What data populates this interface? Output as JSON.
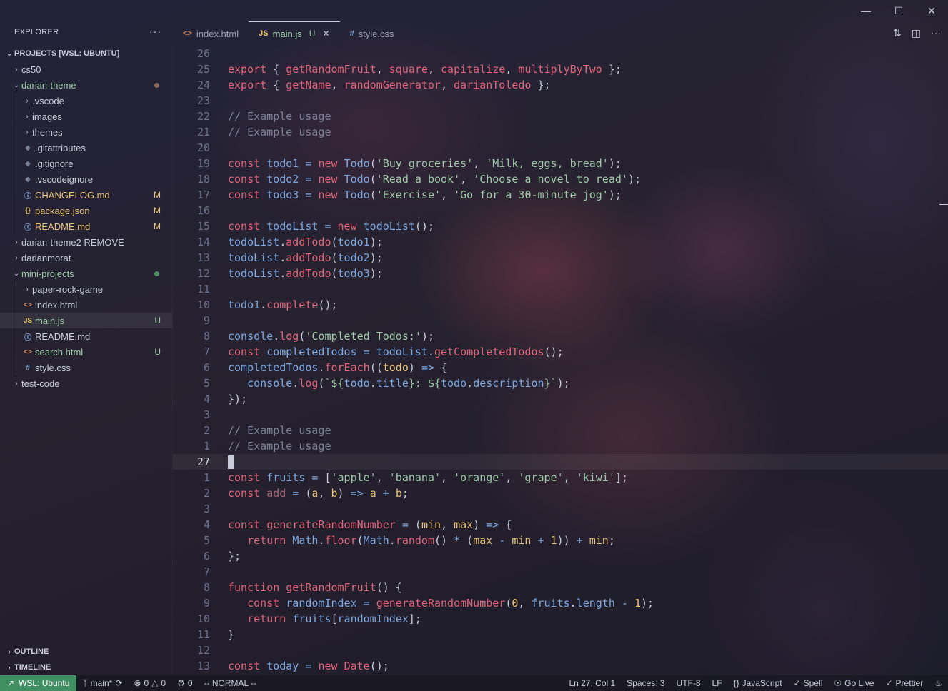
{
  "explorer": {
    "title": "EXPLORER",
    "more": "···",
    "root": "PROJECTS [WSL: UBUNTU]",
    "tree": [
      {
        "label": "cs50",
        "type": "folder",
        "open": false,
        "indent": 0
      },
      {
        "label": "darian-theme",
        "type": "folder",
        "open": true,
        "indent": 0,
        "color": "green",
        "dot": "#8a6a5a"
      },
      {
        "label": ".vscode",
        "type": "folder",
        "open": false,
        "indent": 1
      },
      {
        "label": "images",
        "type": "folder",
        "open": false,
        "indent": 1
      },
      {
        "label": "themes",
        "type": "folder",
        "open": false,
        "indent": 1
      },
      {
        "label": ".gitattributes",
        "type": "file",
        "icon": "◆",
        "iconColor": "muted",
        "indent": 1
      },
      {
        "label": ".gitignore",
        "type": "file",
        "icon": "◆",
        "iconColor": "muted",
        "indent": 1
      },
      {
        "label": ".vscodeignore",
        "type": "file",
        "icon": "◆",
        "iconColor": "muted",
        "indent": 1
      },
      {
        "label": "CHANGELOG.md",
        "type": "file",
        "icon": "ⓘ",
        "iconColor": "blue",
        "indent": 1,
        "color": "yellow",
        "badge": "M"
      },
      {
        "label": "package.json",
        "type": "file",
        "icon": "{}",
        "iconColor": "yellow",
        "indent": 1,
        "color": "yellow",
        "badge": "M"
      },
      {
        "label": "README.md",
        "type": "file",
        "icon": "ⓘ",
        "iconColor": "blue",
        "indent": 1,
        "color": "yellow",
        "badge": "M"
      },
      {
        "label": "darian-theme2 REMOVE",
        "type": "folder",
        "open": false,
        "indent": 0
      },
      {
        "label": "darianmorat",
        "type": "folder",
        "open": false,
        "indent": 0
      },
      {
        "label": "mini-projects",
        "type": "folder",
        "open": true,
        "indent": 0,
        "color": "green",
        "dot": "#4f8f63"
      },
      {
        "label": "paper-rock-game",
        "type": "folder",
        "open": false,
        "indent": 1
      },
      {
        "label": "index.html",
        "type": "file",
        "icon": "<>",
        "iconColor": "orange",
        "indent": 1
      },
      {
        "label": "main.js",
        "type": "file",
        "icon": "JS",
        "iconColor": "yellow",
        "indent": 1,
        "color": "green",
        "badge": "U",
        "selected": true
      },
      {
        "label": "README.md",
        "type": "file",
        "icon": "ⓘ",
        "iconColor": "blue",
        "indent": 1
      },
      {
        "label": "search.html",
        "type": "file",
        "icon": "<>",
        "iconColor": "orange",
        "indent": 1,
        "color": "green",
        "badge": "U"
      },
      {
        "label": "style.css",
        "type": "file",
        "icon": "#",
        "iconColor": "blue",
        "indent": 1
      },
      {
        "label": "test-code",
        "type": "folder",
        "open": false,
        "indent": 0
      }
    ],
    "outline": "OUTLINE",
    "timeline": "TIMELINE"
  },
  "tabs": [
    {
      "label": "index.html",
      "icon": "<>",
      "iconColor": "orange",
      "active": false
    },
    {
      "label": "main.js",
      "icon": "JS",
      "iconColor": "yellow",
      "active": true,
      "status": "U",
      "close": "✕"
    },
    {
      "label": "style.css",
      "icon": "#",
      "iconColor": "blue",
      "active": false
    }
  ],
  "editor": {
    "cursor_line": 27,
    "lines": [
      {
        "n": "26",
        "tokens": []
      },
      {
        "n": "25",
        "tokens": [
          [
            "kw",
            "export"
          ],
          [
            "p",
            " { "
          ],
          [
            "fn",
            "getRandomFruit"
          ],
          [
            "p",
            ", "
          ],
          [
            "fn",
            "square"
          ],
          [
            "p",
            ", "
          ],
          [
            "fn",
            "capitalize"
          ],
          [
            "p",
            ", "
          ],
          [
            "fn",
            "multiplyByTwo"
          ],
          [
            "p",
            " };"
          ]
        ]
      },
      {
        "n": "24",
        "tokens": [
          [
            "kw",
            "export"
          ],
          [
            "p",
            " { "
          ],
          [
            "fn",
            "getName"
          ],
          [
            "p",
            ", "
          ],
          [
            "fn",
            "randomGenerator"
          ],
          [
            "p",
            ", "
          ],
          [
            "fn",
            "darianToledo"
          ],
          [
            "p",
            " };"
          ]
        ]
      },
      {
        "n": "23",
        "tokens": []
      },
      {
        "n": "22",
        "tokens": [
          [
            "cmt",
            "// Example usage"
          ]
        ]
      },
      {
        "n": "21",
        "tokens": [
          [
            "cmt",
            "// Example usage"
          ]
        ]
      },
      {
        "n": "20",
        "tokens": []
      },
      {
        "n": "19",
        "tokens": [
          [
            "kw",
            "const "
          ],
          [
            "var",
            "todo1"
          ],
          [
            "op",
            " = "
          ],
          [
            "kw",
            "new "
          ],
          [
            "var",
            "Todo"
          ],
          [
            "p",
            "("
          ],
          [
            "str",
            "'Buy groceries'"
          ],
          [
            "p",
            ", "
          ],
          [
            "str",
            "'Milk, eggs, bread'"
          ],
          [
            "p",
            ");"
          ]
        ]
      },
      {
        "n": "18",
        "tokens": [
          [
            "kw",
            "const "
          ],
          [
            "var",
            "todo2"
          ],
          [
            "op",
            " = "
          ],
          [
            "kw",
            "new "
          ],
          [
            "var",
            "Todo"
          ],
          [
            "p",
            "("
          ],
          [
            "str",
            "'Read a book'"
          ],
          [
            "p",
            ", "
          ],
          [
            "str",
            "'Choose a novel to read'"
          ],
          [
            "p",
            ");"
          ]
        ]
      },
      {
        "n": "17",
        "tokens": [
          [
            "kw",
            "const "
          ],
          [
            "var",
            "todo3"
          ],
          [
            "op",
            " = "
          ],
          [
            "kw",
            "new "
          ],
          [
            "var",
            "Todo"
          ],
          [
            "p",
            "("
          ],
          [
            "str",
            "'Exercise'"
          ],
          [
            "p",
            ", "
          ],
          [
            "str",
            "'Go for a 30-minute jog'"
          ],
          [
            "p",
            ");"
          ]
        ]
      },
      {
        "n": "16",
        "tokens": []
      },
      {
        "n": "15",
        "tokens": [
          [
            "kw",
            "const "
          ],
          [
            "var",
            "todoList"
          ],
          [
            "op",
            " = "
          ],
          [
            "kw",
            "new "
          ],
          [
            "var",
            "todoList"
          ],
          [
            "p",
            "();"
          ]
        ]
      },
      {
        "n": "14",
        "tokens": [
          [
            "var",
            "todoList"
          ],
          [
            "p",
            "."
          ],
          [
            "fn",
            "addTodo"
          ],
          [
            "p",
            "("
          ],
          [
            "var",
            "todo1"
          ],
          [
            "p",
            ");"
          ]
        ]
      },
      {
        "n": "13",
        "tokens": [
          [
            "var",
            "todoList"
          ],
          [
            "p",
            "."
          ],
          [
            "fn",
            "addTodo"
          ],
          [
            "p",
            "("
          ],
          [
            "var",
            "todo2"
          ],
          [
            "p",
            ");"
          ]
        ]
      },
      {
        "n": "12",
        "tokens": [
          [
            "var",
            "todoList"
          ],
          [
            "p",
            "."
          ],
          [
            "fn",
            "addTodo"
          ],
          [
            "p",
            "("
          ],
          [
            "var",
            "todo3"
          ],
          [
            "p",
            ");"
          ]
        ]
      },
      {
        "n": "11",
        "tokens": []
      },
      {
        "n": "10",
        "tokens": [
          [
            "var",
            "todo1"
          ],
          [
            "p",
            "."
          ],
          [
            "fn",
            "complete"
          ],
          [
            "p",
            "();"
          ]
        ]
      },
      {
        "n": "9",
        "tokens": []
      },
      {
        "n": "8",
        "tokens": [
          [
            "var",
            "console"
          ],
          [
            "p",
            "."
          ],
          [
            "fn",
            "log"
          ],
          [
            "p",
            "("
          ],
          [
            "str",
            "'Completed Todos:'"
          ],
          [
            "p",
            ");"
          ]
        ]
      },
      {
        "n": "7",
        "tokens": [
          [
            "kw",
            "const "
          ],
          [
            "var",
            "completedTodos"
          ],
          [
            "op",
            " = "
          ],
          [
            "var",
            "todoList"
          ],
          [
            "p",
            "."
          ],
          [
            "fn",
            "getCompletedTodos"
          ],
          [
            "p",
            "();"
          ]
        ]
      },
      {
        "n": "6",
        "tokens": [
          [
            "var",
            "completedTodos"
          ],
          [
            "p",
            "."
          ],
          [
            "fn",
            "forEach"
          ],
          [
            "p",
            "(("
          ],
          [
            "param",
            "todo"
          ],
          [
            "p",
            ") "
          ],
          [
            "op",
            "=>"
          ],
          [
            "p",
            " {"
          ]
        ]
      },
      {
        "n": "5",
        "tokens": [
          [
            "p",
            "   "
          ],
          [
            "var",
            "console"
          ],
          [
            "p",
            "."
          ],
          [
            "fn",
            "log"
          ],
          [
            "p",
            "("
          ],
          [
            "str",
            "`${"
          ],
          [
            "var",
            "todo"
          ],
          [
            "p",
            "."
          ],
          [
            "prop",
            "title"
          ],
          [
            "str",
            "}: ${"
          ],
          [
            "var",
            "todo"
          ],
          [
            "p",
            "."
          ],
          [
            "prop",
            "description"
          ],
          [
            "str",
            "}`"
          ],
          [
            "p",
            ");"
          ]
        ]
      },
      {
        "n": "4",
        "tokens": [
          [
            "p",
            "});"
          ]
        ]
      },
      {
        "n": "3",
        "tokens": []
      },
      {
        "n": "2",
        "tokens": [
          [
            "cmt",
            "// Example usage"
          ]
        ]
      },
      {
        "n": "1",
        "tokens": [
          [
            "cmt",
            "// Example usage"
          ]
        ]
      },
      {
        "n": "27",
        "tokens": [],
        "current": true
      },
      {
        "n": "1",
        "tokens": [
          [
            "kw",
            "const "
          ],
          [
            "var",
            "fruits"
          ],
          [
            "op",
            " = "
          ],
          [
            "p",
            "["
          ],
          [
            "str",
            "'apple'"
          ],
          [
            "p",
            ", "
          ],
          [
            "str",
            "'banana'"
          ],
          [
            "p",
            ", "
          ],
          [
            "str",
            "'orange'"
          ],
          [
            "p",
            ", "
          ],
          [
            "str",
            "'grape'"
          ],
          [
            "p",
            ", "
          ],
          [
            "str",
            "'kiwi'"
          ],
          [
            "p",
            "];"
          ]
        ]
      },
      {
        "n": "2",
        "tokens": [
          [
            "kw",
            "const "
          ],
          [
            "dim",
            "add"
          ],
          [
            "op",
            " = "
          ],
          [
            "p",
            "("
          ],
          [
            "param",
            "a"
          ],
          [
            "p",
            ", "
          ],
          [
            "param",
            "b"
          ],
          [
            "p",
            ") "
          ],
          [
            "op",
            "=>"
          ],
          [
            "p",
            " "
          ],
          [
            "param",
            "a"
          ],
          [
            "op",
            " + "
          ],
          [
            "param",
            "b"
          ],
          [
            "p",
            ";"
          ]
        ]
      },
      {
        "n": "3",
        "tokens": []
      },
      {
        "n": "4",
        "tokens": [
          [
            "kw",
            "const "
          ],
          [
            "fn",
            "generateRandomNumber"
          ],
          [
            "op",
            " = "
          ],
          [
            "p",
            "("
          ],
          [
            "param",
            "min"
          ],
          [
            "p",
            ", "
          ],
          [
            "param",
            "max"
          ],
          [
            "p",
            ") "
          ],
          [
            "op",
            "=>"
          ],
          [
            "p",
            " {"
          ]
        ]
      },
      {
        "n": "5",
        "tokens": [
          [
            "p",
            "   "
          ],
          [
            "kw",
            "return "
          ],
          [
            "var",
            "Math"
          ],
          [
            "p",
            "."
          ],
          [
            "fn",
            "floor"
          ],
          [
            "p",
            "("
          ],
          [
            "var",
            "Math"
          ],
          [
            "p",
            "."
          ],
          [
            "fn",
            "random"
          ],
          [
            "p",
            "() "
          ],
          [
            "op",
            "*"
          ],
          [
            "p",
            " ("
          ],
          [
            "param",
            "max"
          ],
          [
            "op",
            " - "
          ],
          [
            "param",
            "min"
          ],
          [
            "op",
            " + "
          ],
          [
            "num",
            "1"
          ],
          [
            "p",
            ")) "
          ],
          [
            "op",
            "+"
          ],
          [
            "p",
            " "
          ],
          [
            "param",
            "min"
          ],
          [
            "p",
            ";"
          ]
        ]
      },
      {
        "n": "6",
        "tokens": [
          [
            "p",
            "};"
          ]
        ]
      },
      {
        "n": "7",
        "tokens": []
      },
      {
        "n": "8",
        "tokens": [
          [
            "kw",
            "function "
          ],
          [
            "fn",
            "getRandomFruit"
          ],
          [
            "p",
            "() {"
          ]
        ]
      },
      {
        "n": "9",
        "tokens": [
          [
            "p",
            "   "
          ],
          [
            "kw",
            "const "
          ],
          [
            "var",
            "randomIndex"
          ],
          [
            "op",
            " = "
          ],
          [
            "fn",
            "generateRandomNumber"
          ],
          [
            "p",
            "("
          ],
          [
            "num",
            "0"
          ],
          [
            "p",
            ", "
          ],
          [
            "var",
            "fruits"
          ],
          [
            "p",
            "."
          ],
          [
            "prop",
            "length"
          ],
          [
            "op",
            " - "
          ],
          [
            "num",
            "1"
          ],
          [
            "p",
            ");"
          ]
        ]
      },
      {
        "n": "10",
        "tokens": [
          [
            "p",
            "   "
          ],
          [
            "kw",
            "return "
          ],
          [
            "var",
            "fruits"
          ],
          [
            "p",
            "["
          ],
          [
            "var",
            "randomIndex"
          ],
          [
            "p",
            "];"
          ]
        ]
      },
      {
        "n": "11",
        "tokens": [
          [
            "p",
            "}"
          ]
        ]
      },
      {
        "n": "12",
        "tokens": []
      },
      {
        "n": "13",
        "tokens": [
          [
            "kw",
            "const "
          ],
          [
            "var",
            "today"
          ],
          [
            "op",
            " = "
          ],
          [
            "kw",
            "new "
          ],
          [
            "fn",
            "Date"
          ],
          [
            "p",
            "();"
          ]
        ]
      }
    ]
  },
  "statusbar": {
    "remote": "WSL: Ubuntu",
    "branch": "main*",
    "errors": "0",
    "warnings": "0",
    "ports": "0",
    "mode": "-- NORMAL --",
    "position": "Ln 27, Col 1",
    "spaces": "Spaces: 3",
    "encoding": "UTF-8",
    "eol": "LF",
    "language": "JavaScript",
    "spell": "Spell",
    "golive": "Go Live",
    "prettier": "Prettier"
  },
  "colors": {
    "accent_green": "#3f8f63",
    "keyword": "#e0657a",
    "string": "#9fc9a9",
    "variable": "#7fa8e0",
    "comment": "#7b8096"
  }
}
